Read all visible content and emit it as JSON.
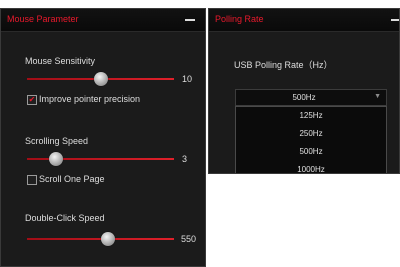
{
  "colors": {
    "accent": "#e8192c",
    "panel_bg": "#1b1b1b",
    "titlebar_bg": "#0e0e0e"
  },
  "mouse_panel": {
    "title": "Mouse Parameter",
    "sensitivity": {
      "label": "Mouse Sensitivity",
      "value": "10",
      "level": 0.5
    },
    "precision": {
      "label": "Improve pointer precision",
      "checked": true
    },
    "scroll": {
      "label": "Scrolling Speed",
      "value": "3",
      "level": 0.2
    },
    "scroll_page": {
      "label": "Scroll One Page",
      "checked": false
    },
    "double_click": {
      "label": "Double-Click Speed",
      "value": "550",
      "level": 0.55
    }
  },
  "polling_panel": {
    "title": "Polling Rate",
    "label": "USB Polling Rate（Hz）",
    "selected": "500Hz",
    "options": [
      "125Hz",
      "250Hz",
      "500Hz",
      "1000Hz"
    ]
  }
}
